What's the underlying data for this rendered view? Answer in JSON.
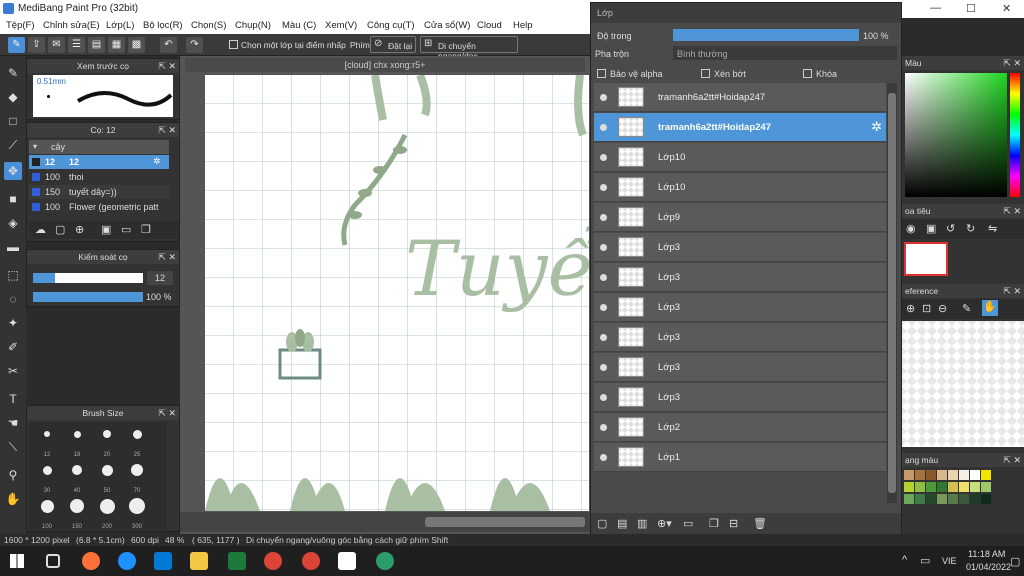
{
  "app": {
    "title": "MediBang Paint Pro (32bit)",
    "window_controls": [
      "—",
      "☐",
      "✕"
    ]
  },
  "menu": [
    "Tệp(F)",
    "Chỉnh sửa(E)",
    "Lớp(L)",
    "Bộ lọc(R)",
    "Chọn(S)",
    "Chụp(N)",
    "Màu (C)",
    "Xem(V)",
    "Công cụ(T)",
    "Cửa sổ(W)",
    "Cloud",
    "Help"
  ],
  "toolbar": {
    "select_one_layer": "Chọn một lớp tại điểm nhấp",
    "snap_label": "Phím",
    "reset_button": "Đặt lại",
    "move_mode": "Di chuyển ngang/dọc"
  },
  "brush_preview": {
    "title": "Xem trước cọ",
    "size": "0.51mm"
  },
  "brush_panel": {
    "title": "Cọ: 12",
    "group": "cây",
    "items": [
      {
        "size": "12",
        "name": "12"
      },
      {
        "size": "100",
        "name": "thoi"
      },
      {
        "size": "150",
        "name": "tuyết dây=))"
      },
      {
        "size": "100",
        "name": "Flower (geometric patt"
      }
    ]
  },
  "brush_control": {
    "title": "Kiểm soát cọ",
    "size": "12",
    "opacity": "100 %",
    "size_fraction": 0.2,
    "opacity_fraction": 1.0
  },
  "brush_size": {
    "title": "Brush Size",
    "sizes": [
      "12",
      "18",
      "20",
      "25",
      "30",
      "40",
      "50",
      "70",
      "100",
      "150",
      "200",
      "300"
    ]
  },
  "canvas": {
    "tab": "[cloud] chx xong:r5+",
    "art_text": "Tuyển"
  },
  "layer_panel": {
    "title": "Lớp",
    "opacity_label": "Độ trong",
    "opacity_value": "100 %",
    "opacity_fraction": 1.0,
    "blend_label": "Pha trộn",
    "blend_value": "Bình thường",
    "protect_alpha": "Bảo vệ alpha",
    "clipping": "Xén bớt",
    "lock": "Khóa",
    "layers": [
      {
        "name": "tramanh6a2tt#Hoidap247",
        "selected": false
      },
      {
        "name": "tramanh6a2tt#Hoidap247",
        "selected": true
      },
      {
        "name": "Lớp10",
        "selected": false
      },
      {
        "name": "Lớp10",
        "selected": false
      },
      {
        "name": "Lớp9",
        "selected": false
      },
      {
        "name": "Lớp3",
        "selected": false
      },
      {
        "name": "Lớp3",
        "selected": false
      },
      {
        "name": "Lớp3",
        "selected": false
      },
      {
        "name": "Lớp3",
        "selected": false
      },
      {
        "name": "Lớp3",
        "selected": false
      },
      {
        "name": "Lớp3",
        "selected": false
      },
      {
        "name": "Lớp2",
        "selected": false
      },
      {
        "name": "Lớp1",
        "selected": false
      }
    ]
  },
  "right": {
    "color_title": "Màu",
    "nav_title": "oa tiêu",
    "ref_title": "eference",
    "palette_title": "ạng màu"
  },
  "status": {
    "size": "1600 * 1200 pixel",
    "cm": "(6.8 * 5.1cm)",
    "dpi": "600 dpi",
    "zoom": "48 %",
    "coords": "( 635, 1177 )",
    "hint": "Di chuyển ngang/vuông góc bằng cách giữ phím Shift"
  },
  "taskbar": {
    "time": "11:18 AM",
    "date": "01/04/2022",
    "lang": "VIE"
  },
  "colors": {
    "accent": "#4f96d8",
    "plant": "#a9bfa3"
  }
}
